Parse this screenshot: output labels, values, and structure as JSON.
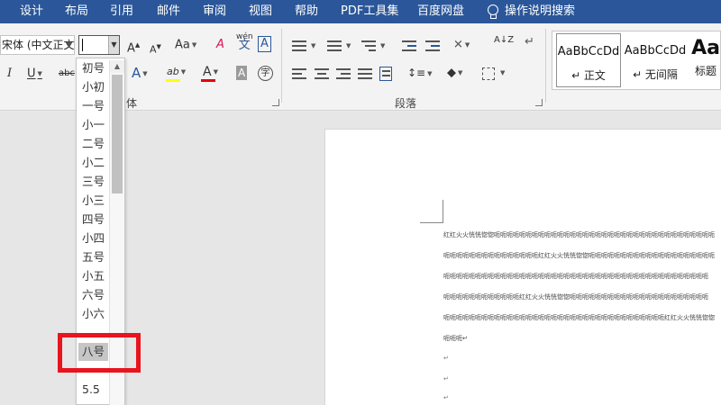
{
  "tabs": [
    "设计",
    "布局",
    "引用",
    "邮件",
    "审阅",
    "视图",
    "帮助",
    "PDF工具集",
    "百度网盘",
    "操作说明搜索"
  ],
  "font": {
    "name": "宋体 (中文正文)",
    "size": ""
  },
  "ribbon": {
    "grow_font": "A",
    "shrink_font": "A",
    "change_case": "Aa",
    "clear_format": "A",
    "phonetic_top": "wén",
    "phonetic_bottom": "文",
    "char_border": "A",
    "italic": "I",
    "underline": "U",
    "strikethrough": "abc",
    "text_effects": "A",
    "highlight": "ab",
    "font_color": "A",
    "char_shading": "A",
    "enclose": "字",
    "font_group_label_tail": "体",
    "paragraph_label": "段落",
    "sort": "A↓Z",
    "show_marks": "↵"
  },
  "styles": {
    "items": [
      {
        "sample": "AaBbCcDd",
        "name": "↵ 正文"
      },
      {
        "sample": "AaBbCcDd",
        "name": "↵ 无间隔"
      },
      {
        "sample": "Aa",
        "name": "标题"
      }
    ]
  },
  "font_size_list": {
    "items": [
      "初号",
      "小初",
      "一号",
      "小一",
      "二号",
      "小二",
      "三号",
      "小三",
      "四号",
      "小四",
      "五号",
      "小五",
      "六号",
      "小六"
    ],
    "selected": "八号",
    "after": "5.5"
  },
  "document": {
    "lines": [
      "红红火火恍恍惚惚呃呃呃呃呃呃呃呃呃呃呃呃呃呃呃呃呃呃呃呃呃呃呃呃呃呃呃呃呃呃呃呃呃呃呃",
      "呃呃呃呃呃呃呃呃呃呃呃呃呃呃呃红红火火恍恍惚惚呃呃呃呃呃呃呃呃呃呃呃呃呃呃呃呃呃呃呃呃",
      "呃呃呃呃呃呃呃呃呃呃呃呃呃呃呃呃呃呃呃呃呃呃呃呃呃呃呃呃呃呃呃呃呃呃呃呃呃呃呃呃呃呃",
      "呃呃呃呃呃呃呃呃呃呃呃呃红红火火恍恍惚惚呃呃呃呃呃呃呃呃呃呃呃呃呃呃呃呃呃呃呃呃呃呃",
      "呃呃呃呃呃呃呃呃呃呃呃呃呃呃呃呃呃呃呃呃呃呃呃呃呃呃呃呃呃呃呃呃呃呃呃红红火火恍恍惚惚",
      "呃呃呃↵"
    ],
    "para_mark": "↵"
  }
}
